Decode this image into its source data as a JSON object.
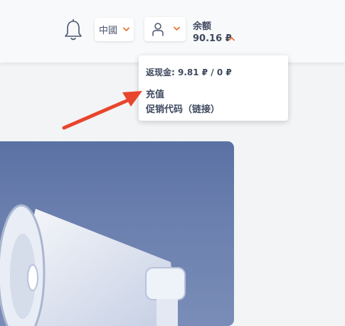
{
  "header": {
    "language": {
      "label": "中國"
    },
    "balance": {
      "label": "余额",
      "amount": "90.16 ₽"
    }
  },
  "dropdown": {
    "cashback": "返现金: 9.81 ₽ / 0 ₽",
    "items": [
      "充值",
      "促销代码（链接）"
    ]
  },
  "icons": {
    "bell": "bell-icon",
    "user": "user-icon",
    "chevron": "chevron-down-icon",
    "megaphone": "megaphone-icon"
  },
  "colors": {
    "accent": "#e8713a",
    "text": "#3e4a60",
    "banner": "#6a7fae",
    "annotation_arrow": "#e8452c"
  }
}
